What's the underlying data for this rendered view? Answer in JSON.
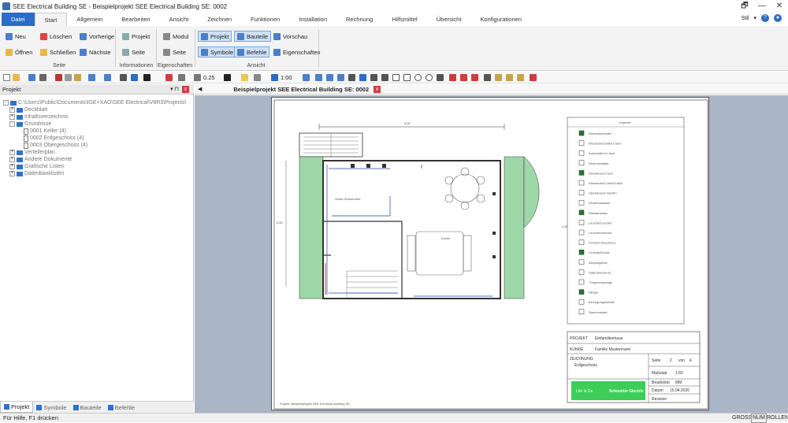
{
  "window": {
    "title": "SEE Electrical Building SE - Beispielprojekt SEE Electrical Building SE: 0002"
  },
  "window_controls": [
    "🗗",
    "—",
    "✕"
  ],
  "menu": {
    "tabs": [
      "Datei",
      "Start",
      "Allgemein",
      "Bearbeiten",
      "Ansicht",
      "Zeichnen",
      "Funktionen",
      "Installation",
      "Rechnung",
      "Hilfsmittel",
      "Übersicht",
      "Konfigurationen"
    ],
    "active": "Start",
    "style_label": "Stil",
    "help_glyph": "?"
  },
  "ribbon": {
    "seite": {
      "buttons": [
        "Neu",
        "Löschen",
        "Vorherige",
        "Öffnen",
        "Schließen",
        "Nächste"
      ],
      "label": "Seite"
    },
    "informationen": {
      "buttons": [
        "Projekt",
        "Seite"
      ],
      "label": "Informationen"
    },
    "eigenschaften": {
      "buttons": [
        "Modul",
        "Seite"
      ],
      "label": "Eigenschaften"
    },
    "ansicht": {
      "buttons": [
        "Projekt",
        "Bauteile",
        "Vorschau",
        "Symbole",
        "Befehle",
        "Eigenschaften"
      ],
      "label": "Ansicht"
    }
  },
  "toolbar": {
    "line_width": "0.25",
    "scale": "1:00"
  },
  "project_panel": {
    "title": "Projekt",
    "pin": "▾ ⊓",
    "close": "x",
    "tree": [
      {
        "label": "C:\\Users\\Public\\Documents\\IGE+XAO\\SEE Electrical\\V8R3\\Projects\\",
        "level": 0
      },
      {
        "label": "Deckblatt",
        "level": 1
      },
      {
        "label": "Inhaltsverzeichnis",
        "level": 1
      },
      {
        "label": "Grundrisse",
        "level": 1
      },
      {
        "label": "0001 Keller (4)",
        "level": 2
      },
      {
        "label": "0002 Erdgeschoss (4)",
        "level": 2
      },
      {
        "label": "0003 Obergeschoss (4)",
        "level": 2
      },
      {
        "label": "Verteilerplan",
        "level": 1
      },
      {
        "label": "Andere Dokumente",
        "level": 1
      },
      {
        "label": "Grafische Listen",
        "level": 1
      },
      {
        "label": "Datenbanklisten",
        "level": 1
      }
    ],
    "bottom_tabs": [
      "Projekt",
      "Symbole",
      "Bauteile",
      "Befehle"
    ]
  },
  "document": {
    "tab_title": "Beispielprojekt SEE Electrical Building SE: 0002",
    "nav_left": "◀",
    "close": "x"
  },
  "drawing": {
    "legend_title": "Legende",
    "legend_items": [
      "Wechselschalter",
      "Wechselschalter/1-fach",
      "Ausschalter/1-fach",
      "Serienschalter",
      "Steckdose/1-fach",
      "Steckdose/1-fach/3-fach",
      "Steckdose/1-fach/FI",
      "Deckenauslass",
      "Wandauslass",
      "Leuchte/Leuchte",
      "Leuchtenstrecke",
      "Fernseh-Anschluss",
      "Leuchte/Decke",
      "Abzweigdose",
      "Datenanschluss",
      "Türsprechanlage",
      "Klingel",
      "Bewegungsmelder",
      "Rauchmelder"
    ],
    "room_labels": [
      "Wohn-/Esszimmer",
      "Küche"
    ],
    "dimension_left": "6,50",
    "dimension_top": "8,50",
    "dimension_right": "4,85",
    "titleblock": {
      "project_label": "PROJEKT",
      "project_value": "Einfamilienhaus",
      "customer_label": "KUNDE",
      "customer_value": "Familie Mustermann",
      "drawing_label": "ZEICHNUNG",
      "drawing_value": "Erdgeschoss",
      "page_label": "Seite",
      "page_value": "2",
      "von_label": "von",
      "von_value": "4",
      "scale_label": "Maßstab",
      "scale_value": "1:50",
      "drawn_label": "Bearbeitet",
      "drawn_value": "MM",
      "date_label": "Datum",
      "date_value": "15.04.2020",
      "checked_label": "Revision",
      "logo_left": "Life Is On",
      "logo_right": "Schneider Electric",
      "footer": "Projekt: Beispielprojekt SEE Electrical Building SE"
    }
  },
  "status": {
    "left": "Für Hilfe, F1 drücken",
    "indicators": [
      "GROSS",
      "NUM",
      "ROLLEN"
    ]
  },
  "colors": {
    "accent": "#2b6cc4",
    "ribbon_bg": "#f3f3f3",
    "canvas_bg": "#aab5c5",
    "garden": "#9fd8a8",
    "wall": "#333333",
    "wire_blue": "#1e3fb4",
    "wire_red": "#c0204a",
    "logo_green": "#3dcd58"
  }
}
